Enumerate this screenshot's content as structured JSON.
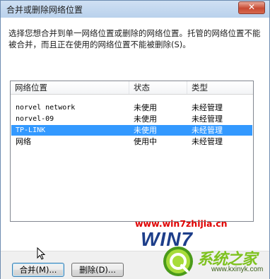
{
  "window": {
    "title": "合并或删除网络位置",
    "close_symbol": "✕"
  },
  "description": "选择您想合并到单一网络位置或删除的网络位置。托管的网络位置不能被合并，而且正在使用的网络位置不能被删除(S)。",
  "list": {
    "columns": [
      "网络位置",
      "状态",
      "类型"
    ],
    "rows": [
      {
        "name": "norvel network",
        "status": "未使用",
        "type": "未经管理",
        "selected": false
      },
      {
        "name": "norvel-09",
        "status": "未使用",
        "type": "未经管理",
        "selected": false
      },
      {
        "name": "TP-LINK",
        "status": "未使用",
        "type": "未经管理",
        "selected": true
      },
      {
        "name": "网络",
        "status": "使用中",
        "type": "未经管理",
        "selected": false
      }
    ]
  },
  "buttons": {
    "merge_label": "合并(M)...",
    "delete_label": "删除(D)..."
  },
  "watermark": {
    "url": "www.win7zhijia.cn",
    "win7_text": "WIN7",
    "brand": "系统之家",
    "site": "www.kxinyk.com",
    "colors": {
      "url": "#e00000",
      "win7": "#1d3e8a",
      "brand": "#7ec21f"
    }
  },
  "colors": {
    "selection": "#3399ff",
    "title_bar": "#b9d1ec",
    "close_button": "#c84a32"
  }
}
